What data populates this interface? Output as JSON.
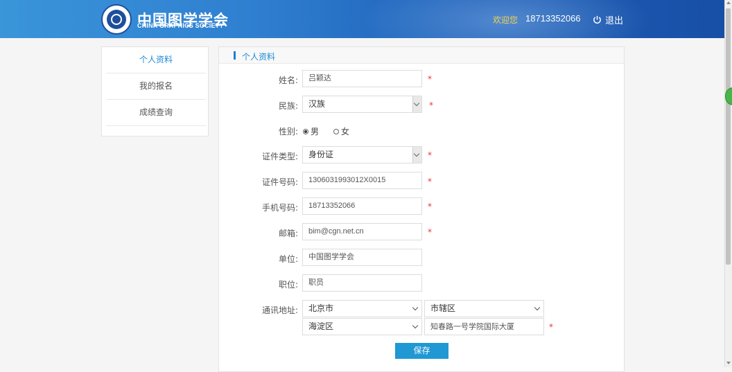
{
  "header": {
    "logo_cn": "中国图学学会",
    "logo_en": "CHINA GRAPHICS SOCIETY",
    "welcome": "欢迎您",
    "phone": "18713352066",
    "logout": "退出"
  },
  "sidebar": {
    "items": [
      {
        "label": "个人资料"
      },
      {
        "label": "我的报名"
      },
      {
        "label": "成绩查询"
      }
    ]
  },
  "panel": {
    "title": "个人资料"
  },
  "form": {
    "name": {
      "label": "姓名:",
      "value": "吕颖达"
    },
    "ethnicity": {
      "label": "民族:",
      "value": "汉族"
    },
    "gender": {
      "label": "性别:",
      "male": "男",
      "female": "女",
      "selected": "男"
    },
    "id_type": {
      "label": "证件类型:",
      "value": "身份证"
    },
    "id_number": {
      "label": "证件号码:",
      "value": "1306031993012X0015"
    },
    "mobile": {
      "label": "手机号码:",
      "value": "18713352066"
    },
    "email": {
      "label": "邮箱:",
      "value": "bim@cgn.net.cn"
    },
    "company": {
      "label": "单位:",
      "value": "中国图学学会"
    },
    "position": {
      "label": "职位:",
      "value": "职员"
    },
    "address": {
      "label": "通讯地址:",
      "province": "北京市",
      "city": "市辖区",
      "district": "海淀区",
      "street": "知春路一号学院国际大厦"
    },
    "required_mark": "*",
    "save": "保存"
  }
}
